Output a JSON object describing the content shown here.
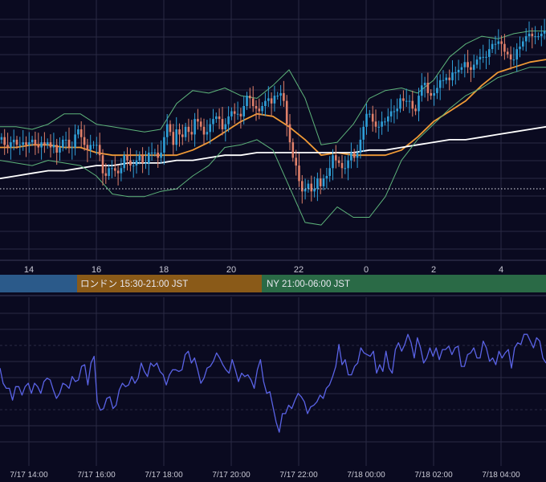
{
  "colors": {
    "background": "#0a0a20",
    "grid": "#2a2a44",
    "candle_up": "#2f9fd8",
    "candle_down": "#e0806a",
    "ma_fast": "#f09a36",
    "ma_slow": "#ffffff",
    "bollinger": "#5db37a",
    "oscillator": "#5a63e6",
    "session_tokyo": "#2b5a8a",
    "session_london": "#8a5a18",
    "session_ny": "#2a6a46"
  },
  "sessions": [
    {
      "label": ""
    },
    {
      "label": "ロンドン 15:30-21:00 JST"
    },
    {
      "label": "NY 21:00-06:00 JST"
    }
  ],
  "chart_data": [
    {
      "type": "candlestick",
      "title": "",
      "x_tick_labels": [
        "14",
        "16",
        "18",
        "20",
        "22",
        "0",
        "2",
        "4"
      ],
      "y_range": [
        0,
        100
      ],
      "grid": true,
      "reference_line_dotted": 36,
      "overlays": [
        {
          "kind": "moving_average_fast",
          "color": "orange",
          "x": [
            0,
            20,
            40,
            60,
            80,
            100,
            120,
            140,
            160,
            180,
            200,
            220,
            240,
            260,
            280,
            300,
            320,
            340,
            360,
            380,
            400,
            420,
            440,
            460,
            480,
            500,
            520,
            540,
            560,
            580,
            600,
            620,
            640,
            660,
            680
          ],
          "y": [
            43,
            43,
            44,
            44,
            43,
            43,
            41,
            40,
            40,
            40,
            40,
            40,
            42,
            45,
            49,
            53,
            56,
            55,
            51,
            46,
            40,
            41,
            40,
            40,
            40,
            42,
            47,
            53,
            57,
            61,
            67,
            72,
            74,
            76,
            77
          ]
        },
        {
          "kind": "moving_average_slow",
          "color": "white",
          "x": [
            0,
            20,
            40,
            60,
            80,
            100,
            120,
            140,
            160,
            180,
            200,
            220,
            240,
            260,
            280,
            300,
            320,
            340,
            360,
            380,
            400,
            420,
            440,
            460,
            480,
            500,
            520,
            540,
            560,
            580,
            600,
            620,
            640,
            660,
            680
          ],
          "y": [
            31,
            32,
            33,
            34,
            34,
            35,
            36,
            36,
            37,
            37,
            37,
            38,
            38,
            39,
            40,
            40,
            41,
            41,
            41,
            41,
            41,
            41,
            41,
            42,
            42,
            43,
            44,
            45,
            46,
            46,
            47,
            48,
            49,
            50,
            51
          ]
        },
        {
          "kind": "bollinger_upper",
          "color": "green",
          "x": [
            0,
            20,
            40,
            60,
            80,
            100,
            120,
            140,
            160,
            180,
            200,
            220,
            240,
            260,
            280,
            300,
            320,
            340,
            360,
            380,
            400,
            420,
            440,
            460,
            480,
            500,
            520,
            540,
            560,
            580,
            600,
            620,
            640,
            660,
            680
          ],
          "y": [
            51,
            51,
            50,
            52,
            56,
            56,
            52,
            51,
            50,
            49,
            50,
            60,
            65,
            64,
            66,
            63,
            62,
            67,
            73,
            62,
            44,
            45,
            52,
            62,
            65,
            66,
            64,
            69,
            78,
            83,
            86,
            85,
            87,
            88,
            88
          ]
        },
        {
          "kind": "bollinger_lower",
          "color": "green",
          "x": [
            0,
            20,
            40,
            60,
            80,
            100,
            120,
            140,
            160,
            180,
            200,
            220,
            240,
            260,
            280,
            300,
            320,
            340,
            360,
            380,
            400,
            420,
            440,
            460,
            480,
            500,
            520,
            540,
            560,
            580,
            600,
            620,
            640,
            660,
            680
          ],
          "y": [
            38,
            37,
            36,
            38,
            37,
            36,
            32,
            25,
            24,
            24,
            26,
            27,
            32,
            36,
            43,
            44,
            46,
            42,
            28,
            14,
            13,
            20,
            16,
            16,
            24,
            38,
            46,
            52,
            58,
            63,
            66,
            70,
            72,
            74,
            74
          ]
        }
      ],
      "candle_series": {
        "up_color": "blue",
        "down_color": "salmon",
        "close_values": [
          47,
          44,
          43,
          45,
          46,
          44,
          44,
          45,
          44,
          45,
          46,
          44,
          43,
          45,
          44,
          45,
          43,
          44,
          41,
          43,
          46,
          46,
          43,
          43,
          48,
          50,
          47,
          44,
          42,
          44,
          44,
          44,
          40,
          33,
          32,
          35,
          35,
          34,
          33,
          35,
          40,
          38,
          36,
          36,
          38,
          40,
          37,
          37,
          41,
          41,
          41,
          39,
          41,
          47,
          52,
          49,
          44,
          50,
          48,
          47,
          51,
          49,
          48,
          54,
          53,
          51,
          48,
          49,
          52,
          54,
          55,
          54,
          50,
          52,
          55,
          57,
          56,
          56,
          55,
          59,
          63,
          62,
          59,
          58,
          57,
          59,
          61,
          62,
          60,
          63,
          63,
          64,
          61,
          52,
          45,
          39,
          36,
          30,
          26,
          27,
          29,
          26,
          27,
          31,
          28,
          31,
          32,
          35,
          40,
          38,
          37,
          35,
          35,
          38,
          41,
          39,
          41,
          46,
          51,
          56,
          56,
          53,
          51,
          51,
          53,
          53,
          55,
          57,
          57,
          58,
          62,
          61,
          61,
          61,
          58,
          57,
          63,
          67,
          68,
          64,
          63,
          64,
          66,
          69,
          69,
          70,
          69,
          72,
          72,
          73,
          74,
          76,
          74,
          73,
          75,
          77,
          78,
          78,
          78,
          81,
          83,
          83,
          84,
          83,
          80,
          79,
          77,
          77,
          81,
          82,
          84,
          86,
          87,
          86,
          86,
          86,
          87,
          88
        ]
      }
    },
    {
      "type": "line",
      "title": "",
      "x_tick_labels": [
        "7/17 14:00",
        "7/17 16:00",
        "7/17 18:00",
        "7/17 20:00",
        "7/17 22:00",
        "7/18 00:00",
        "7/18 02:00",
        "7/18 04:00"
      ],
      "y_range": [
        0,
        100
      ],
      "grid": true,
      "series": [
        {
          "name": "",
          "values": [
            58,
            49,
            46,
            46,
            39,
            47,
            47,
            42,
            47,
            49,
            43,
            49,
            47,
            43,
            50,
            52,
            51,
            45,
            40,
            43,
            49,
            48,
            46,
            53,
            50,
            51,
            59,
            60,
            48,
            61,
            65,
            38,
            33,
            34,
            40,
            41,
            34,
            36,
            45,
            49,
            47,
            48,
            53,
            49,
            52,
            61,
            56,
            53,
            61,
            59,
            61,
            56,
            54,
            48,
            54,
            57,
            57,
            56,
            57,
            66,
            68,
            61,
            64,
            57,
            49,
            52,
            58,
            59,
            62,
            67,
            64,
            60,
            57,
            55,
            63,
            57,
            50,
            55,
            53,
            54,
            51,
            46,
            57,
            63,
            50,
            43,
            44,
            35,
            26,
            20,
            31,
            31,
            36,
            34,
            39,
            43,
            41,
            38,
            31,
            35,
            36,
            38,
            42,
            40,
            46,
            48,
            53,
            59,
            72,
            60,
            63,
            54,
            54,
            59,
            61,
            70,
            67,
            66,
            65,
            68,
            55,
            60,
            56,
            68,
            58,
            55,
            69,
            73,
            68,
            72,
            78,
            73,
            64,
            76,
            70,
            61,
            64,
            70,
            65,
            70,
            63,
            69,
            69,
            71,
            66,
            70,
            71,
            59,
            59,
            66,
            67,
            70,
            64,
            64,
            74,
            70,
            62,
            64,
            60,
            68,
            64,
            67,
            69,
            58,
            70,
            73,
            72,
            78,
            78,
            74,
            70,
            76,
            74,
            64,
            61
          ]
        }
      ]
    }
  ]
}
